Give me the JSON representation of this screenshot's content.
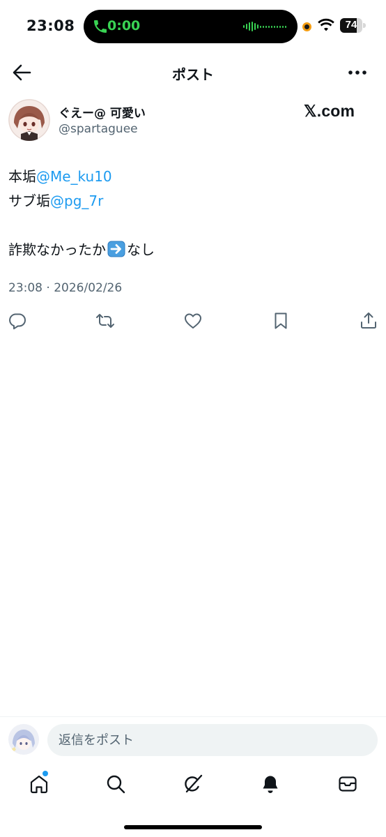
{
  "status_bar": {
    "time": "23:08",
    "call_duration": "0:00",
    "battery_level": "74",
    "battery_fraction": 0.74
  },
  "header": {
    "title": "ポスト"
  },
  "post": {
    "author_name": "ぐえー@ 可愛い",
    "author_handle": "@spartaguee",
    "source_label": "𝕏.com",
    "line1_prefix": "本垢",
    "line1_mention": "@Me_ku10",
    "line2_prefix": "サブ垢",
    "line2_mention": "@pg_7r",
    "line3_before": "詐欺なかったか",
    "line3_after": "なし",
    "timestamp": "23:08 · 2026/02/26"
  },
  "reply": {
    "placeholder": "返信をポスト"
  },
  "icons": {
    "actions": [
      "reply-icon",
      "repost-icon",
      "like-icon",
      "bookmark-icon",
      "share-icon"
    ],
    "nav": [
      "home-icon",
      "search-icon",
      "grok-icon",
      "notifications-icon",
      "messages-icon"
    ]
  },
  "colors": {
    "accent": "#1d9bf0",
    "text": "#0f1419",
    "secondary": "#536471",
    "call_green": "#39d353"
  }
}
